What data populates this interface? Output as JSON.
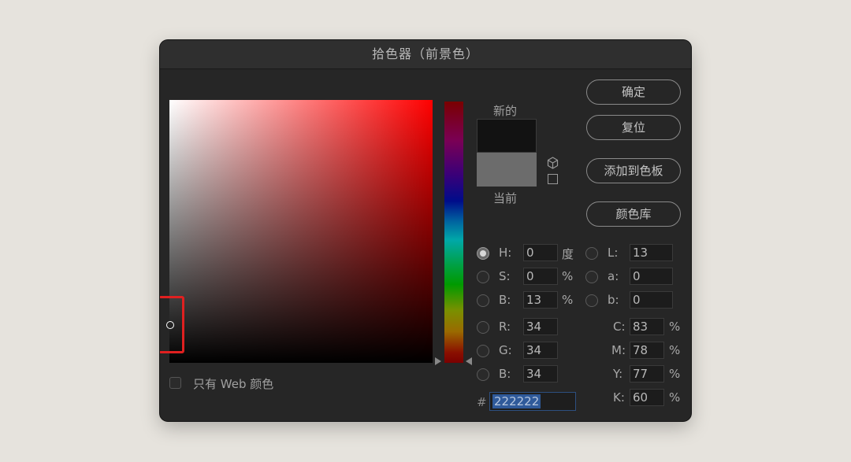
{
  "dialog": {
    "title": "拾色器（前景色）"
  },
  "web_only": {
    "label": "只有 Web 颜色",
    "checked": false
  },
  "preview": {
    "new_label": "新的",
    "current_label": "当前",
    "new_color": "#121212",
    "current_color": "#6c6c6c"
  },
  "buttons": {
    "ok": "确定",
    "reset": "复位",
    "add_to_swatches": "添加到色板",
    "color_libraries": "颜色库"
  },
  "hsb": {
    "h": {
      "label": "H:",
      "value": "0",
      "unit": "度",
      "selected": true
    },
    "s": {
      "label": "S:",
      "value": "0",
      "unit": "%"
    },
    "b": {
      "label": "B:",
      "value": "13",
      "unit": "%"
    }
  },
  "lab": {
    "l": {
      "label": "L:",
      "value": "13"
    },
    "a": {
      "label": "a:",
      "value": "0"
    },
    "b": {
      "label": "b:",
      "value": "0"
    }
  },
  "rgb": {
    "r": {
      "label": "R:",
      "value": "34"
    },
    "g": {
      "label": "G:",
      "value": "34"
    },
    "b": {
      "label": "B:",
      "value": "34"
    }
  },
  "cmyk": {
    "c": {
      "label": "C:",
      "value": "83",
      "unit": "%"
    },
    "m": {
      "label": "M:",
      "value": "78",
      "unit": "%"
    },
    "y": {
      "label": "Y:",
      "value": "77",
      "unit": "%"
    },
    "k": {
      "label": "K:",
      "value": "60",
      "unit": "%"
    }
  },
  "hex": {
    "symbol": "#",
    "value": "222222"
  },
  "colors": {
    "dialog_bg": "#262626",
    "highlight": "#e02020",
    "hex_selection": "#2f5a9a"
  }
}
